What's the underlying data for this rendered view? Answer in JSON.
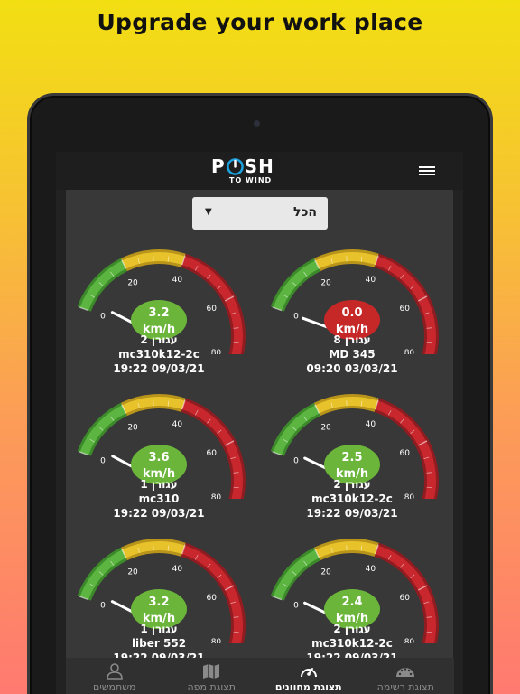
{
  "headline": "Upgrade your work place",
  "app": {
    "logo_main": "SH",
    "logo_first": "P",
    "logo_sub": "TO WIND",
    "filter": {
      "selected": "הכל"
    }
  },
  "gauge_scale": {
    "min": 0,
    "max": 120,
    "ticks": [
      "0",
      "20",
      "40",
      "60",
      "80",
      "100",
      "120"
    ]
  },
  "gauges": [
    {
      "value": 3.2,
      "display": "3.2",
      "unit": "km/h",
      "status": "green",
      "name": "עגורן 2",
      "model": "mc310k12-2c",
      "timestamp": "19:22 09/03/21"
    },
    {
      "value": 0.0,
      "display": "0.0",
      "unit": "km/h",
      "status": "red",
      "name": "עגורן 8",
      "model": "MD 345",
      "timestamp": "09:20 03/03/21"
    },
    {
      "value": 3.6,
      "display": "3.6",
      "unit": "km/h",
      "status": "green",
      "name": "עגורן 1",
      "model": "mc310",
      "timestamp": "19:22 09/03/21"
    },
    {
      "value": 2.5,
      "display": "2.5",
      "unit": "km/h",
      "status": "green",
      "name": "עגורן 2",
      "model": "mc310k12-2c",
      "timestamp": "19:22 09/03/21"
    },
    {
      "value": 3.2,
      "display": "3.2",
      "unit": "km/h",
      "status": "green",
      "name": "עגורן 1",
      "model": "liber 552",
      "timestamp": "19:22 09/03/21"
    },
    {
      "value": 2.4,
      "display": "2.4",
      "unit": "km/h",
      "status": "green",
      "name": "עגורן 2",
      "model": "mc310k12-2c",
      "timestamp": "19:22 09/03/21"
    }
  ],
  "tabs": [
    {
      "label": "משתמשים",
      "icon": "user-icon",
      "active": false
    },
    {
      "label": "תצוגת מפה",
      "icon": "map-icon",
      "active": false
    },
    {
      "label": "תצוגת מחוונים",
      "icon": "gauge-icon",
      "active": true
    },
    {
      "label": "תצוגת רשימה",
      "icon": "dashboard-icon",
      "active": false
    }
  ],
  "colors": {
    "green": "#5cb541",
    "yellow": "#e8c22a",
    "red": "#c8272d",
    "badge_green": "#6ab53a",
    "badge_red": "#c62828"
  }
}
